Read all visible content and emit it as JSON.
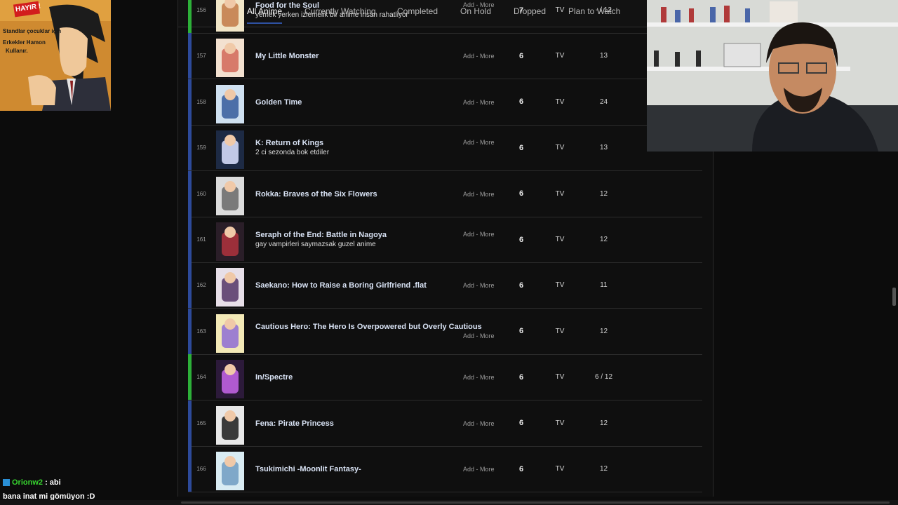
{
  "tabs": [
    {
      "label": "All Anime",
      "active": true
    },
    {
      "label": "Currently Watching",
      "active": false
    },
    {
      "label": "Completed",
      "active": false
    },
    {
      "label": "On Hold",
      "active": false
    },
    {
      "label": "Dropped",
      "active": false
    },
    {
      "label": "Plan to Watch",
      "active": false
    }
  ],
  "status_colors": {
    "completed": "#2d4a9a",
    "watching": "#2db039"
  },
  "add_more_label": "Add - More",
  "rows": [
    {
      "num": "156",
      "title": "Food for the Soul",
      "note": "yemek yerken izlemelik bir anime insan rahatliyor",
      "score": "7",
      "type": "TV",
      "progress": "- / 12",
      "status": "watching"
    },
    {
      "num": "157",
      "title": "My Little Monster",
      "note": "",
      "score": "6",
      "type": "TV",
      "progress": "13",
      "status": "completed"
    },
    {
      "num": "158",
      "title": "Golden Time",
      "note": "",
      "score": "6",
      "type": "TV",
      "progress": "24",
      "status": "completed"
    },
    {
      "num": "159",
      "title": "K: Return of Kings",
      "note": "2 ci sezonda bok etdiler",
      "score": "6",
      "type": "TV",
      "progress": "13",
      "status": "completed"
    },
    {
      "num": "160",
      "title": "Rokka: Braves of the Six Flowers",
      "note": "",
      "score": "6",
      "type": "TV",
      "progress": "12",
      "status": "completed"
    },
    {
      "num": "161",
      "title": "Seraph of the End: Battle in Nagoya",
      "note": "gay vampirleri saymazsak guzel anime",
      "score": "6",
      "type": "TV",
      "progress": "12",
      "status": "completed"
    },
    {
      "num": "162",
      "title": "Saekano: How to Raise a Boring Girlfriend .flat",
      "note": "",
      "score": "6",
      "type": "TV",
      "progress": "11",
      "status": "completed"
    },
    {
      "num": "163",
      "title": "Cautious Hero: The Hero Is Overpowered but Overly Cautious",
      "note": "",
      "score": "6",
      "type": "TV",
      "progress": "12",
      "status": "completed"
    },
    {
      "num": "164",
      "title": "In/Spectre",
      "note": "",
      "score": "6",
      "type": "TV",
      "progress": "6 / 12",
      "status": "watching"
    },
    {
      "num": "165",
      "title": "Fena: Pirate Princess",
      "note": "",
      "score": "6",
      "type": "TV",
      "progress": "12",
      "status": "completed"
    },
    {
      "num": "166",
      "title": "Tsukimichi -Moonlit Fantasy-",
      "note": "",
      "score": "6",
      "type": "TV",
      "progress": "12",
      "status": "completed"
    }
  ],
  "overlay_left": {
    "badge": "HAYIR !",
    "line1": "Standlar çocuklar için",
    "line2": "Erkekler Hamon",
    "line3": "Kullanır."
  },
  "chat": [
    {
      "user": "Orionw2",
      "text": " : abi"
    },
    {
      "user": "",
      "text": "bana inat mi gömüyon :D"
    }
  ]
}
